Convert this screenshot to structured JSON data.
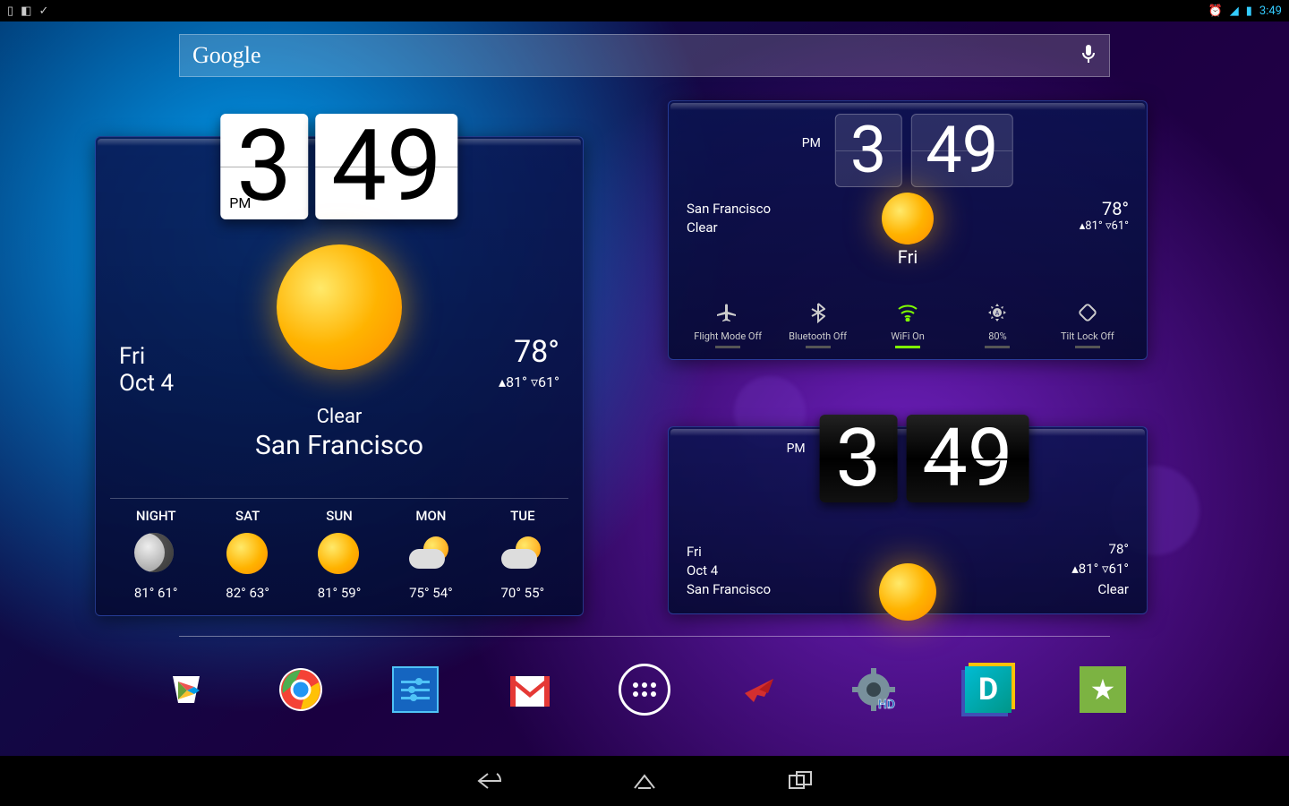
{
  "statusbar": {
    "time": "3:49"
  },
  "search": {
    "logo": "Google"
  },
  "clock": {
    "hour": "3",
    "minute": "49",
    "ampm": "PM"
  },
  "widgetA": {
    "day": "Fri",
    "date": "Oct 4",
    "temp": "78°",
    "hi": "▴81°",
    "lo": "▿61°",
    "condition": "Clear",
    "location": "San Francisco",
    "forecast": [
      {
        "label": "NIGHT",
        "hi": "81°",
        "lo": "61°",
        "icon": "moon"
      },
      {
        "label": "SAT",
        "hi": "82°",
        "lo": "63°",
        "icon": "sun"
      },
      {
        "label": "SUN",
        "hi": "81°",
        "lo": "59°",
        "icon": "sun"
      },
      {
        "label": "MON",
        "hi": "75°",
        "lo": "54°",
        "icon": "cloud-sun"
      },
      {
        "label": "TUE",
        "hi": "70°",
        "lo": "55°",
        "icon": "cloud-sun"
      }
    ]
  },
  "widgetB": {
    "location": "San Francisco",
    "condition": "Clear",
    "day": "Fri",
    "temp": "78°",
    "hi": "▴81°",
    "lo": "▿61°",
    "toggles": [
      {
        "name": "Flight Mode Off",
        "icon": "airplane",
        "on": false
      },
      {
        "name": "Bluetooth Off",
        "icon": "bluetooth",
        "on": false
      },
      {
        "name": "WiFi On",
        "icon": "wifi",
        "on": true
      },
      {
        "name": "80%",
        "icon": "brightness",
        "on": false
      },
      {
        "name": "Tilt Lock Off",
        "icon": "tilt",
        "on": false
      }
    ]
  },
  "widgetC": {
    "day": "Fri",
    "date": "Oct 4",
    "location": "San Francisco",
    "temp": "78°",
    "hi": "▴81°",
    "lo": "▿61°",
    "condition": "Clear"
  },
  "dock": [
    {
      "name": "play-store",
      "bg": "#fff"
    },
    {
      "name": "chrome",
      "bg": "transparent"
    },
    {
      "name": "settings",
      "bg": "#1a6fb5"
    },
    {
      "name": "gmail",
      "bg": "#fff"
    },
    {
      "name": "apps",
      "bg": "transparent"
    },
    {
      "name": "hd-plane",
      "bg": "transparent"
    },
    {
      "name": "hd-gear",
      "bg": "transparent"
    },
    {
      "name": "d-app",
      "bg": "#0cc"
    },
    {
      "name": "star-app",
      "bg": "#7da50a"
    }
  ]
}
